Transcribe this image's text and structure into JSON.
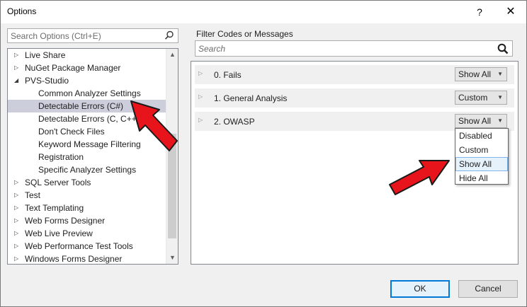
{
  "window": {
    "title": "Options",
    "help_label": "?",
    "close_label": "✕"
  },
  "options_search": {
    "placeholder": "Search Options (Ctrl+E)"
  },
  "tree": {
    "items": [
      {
        "label": "Live Share",
        "level": 0,
        "expander": "▷",
        "selected": false
      },
      {
        "label": "NuGet Package Manager",
        "level": 0,
        "expander": "▷",
        "selected": false
      },
      {
        "label": "PVS-Studio",
        "level": 0,
        "expander": "◢",
        "selected": false
      },
      {
        "label": "Common Analyzer Settings",
        "level": 1,
        "expander": "",
        "selected": false
      },
      {
        "label": "Detectable Errors (C#)",
        "level": 1,
        "expander": "",
        "selected": true
      },
      {
        "label": "Detectable Errors (C, C++)",
        "level": 1,
        "expander": "",
        "selected": false
      },
      {
        "label": "Don't Check Files",
        "level": 1,
        "expander": "",
        "selected": false
      },
      {
        "label": "Keyword Message Filtering",
        "level": 1,
        "expander": "",
        "selected": false
      },
      {
        "label": "Registration",
        "level": 1,
        "expander": "",
        "selected": false
      },
      {
        "label": "Specific Analyzer Settings",
        "level": 1,
        "expander": "",
        "selected": false
      },
      {
        "label": "SQL Server Tools",
        "level": 0,
        "expander": "▷",
        "selected": false
      },
      {
        "label": "Test",
        "level": 0,
        "expander": "▷",
        "selected": false
      },
      {
        "label": "Text Templating",
        "level": 0,
        "expander": "▷",
        "selected": false
      },
      {
        "label": "Web Forms Designer",
        "level": 0,
        "expander": "▷",
        "selected": false
      },
      {
        "label": "Web Live Preview",
        "level": 0,
        "expander": "▷",
        "selected": false
      },
      {
        "label": "Web Performance Test Tools",
        "level": 0,
        "expander": "▷",
        "selected": false
      },
      {
        "label": "Windows Forms Designer",
        "level": 0,
        "expander": "▷",
        "selected": false
      }
    ],
    "scroll_up": "▲",
    "scroll_down": "▼"
  },
  "filter": {
    "group_label": "Filter Codes or Messages",
    "search_placeholder": "Search"
  },
  "codes": {
    "rows": [
      {
        "label": "0. Fails",
        "value": "Show All"
      },
      {
        "label": "1. General Analysis",
        "value": "Custom"
      },
      {
        "label": "2. OWASP",
        "value": "Show All"
      }
    ],
    "caret": "▼",
    "row_triangle": "▷"
  },
  "dropdown": {
    "options": [
      "Disabled",
      "Custom",
      "Show All",
      "Hide All"
    ],
    "highlighted": "Show All"
  },
  "buttons": {
    "ok_label": "OK",
    "cancel_label": "Cancel"
  },
  "colors": {
    "selection": "#cccedb",
    "arrow_fill": "#e8141b",
    "ok_border": "#0078d7",
    "dropdown_highlight": "#e5f1fb"
  },
  "icons": {
    "search_left": "search-icon",
    "search_right": "search-icon",
    "annotation_arrows": "red-arrow-icon"
  }
}
